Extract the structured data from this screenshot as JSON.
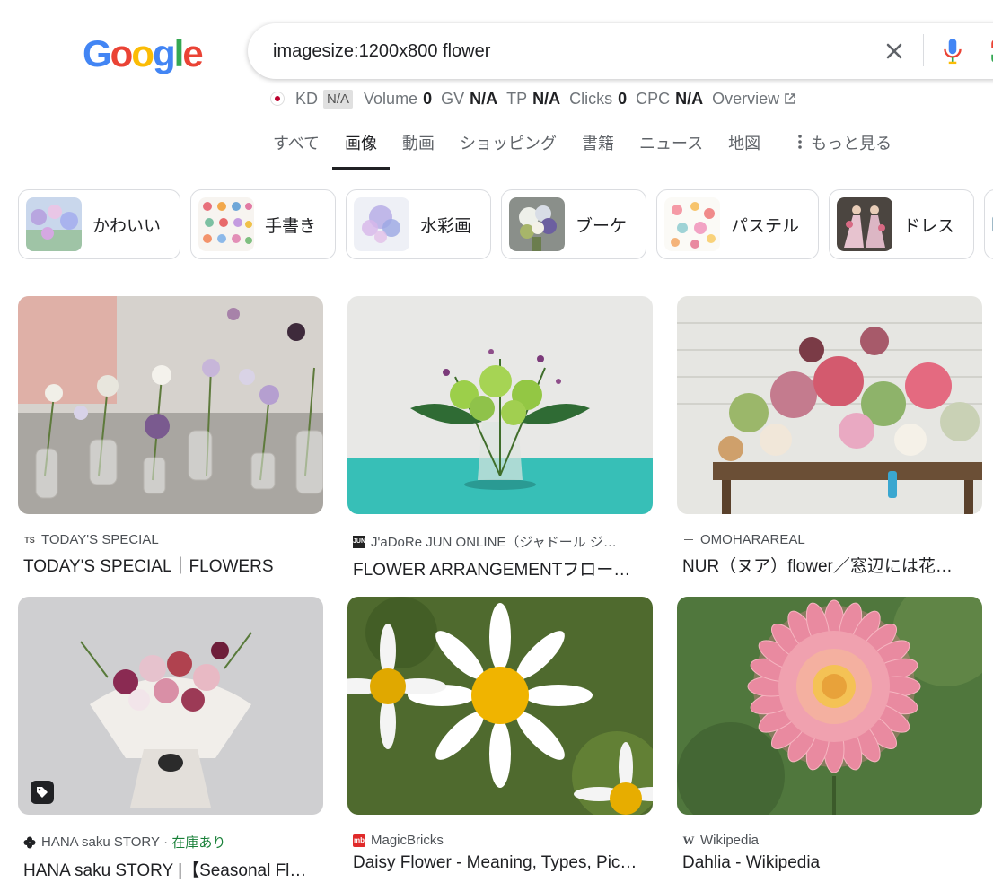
{
  "logo": {
    "text": "Google"
  },
  "search": {
    "query": "imagesize:1200x800 flower"
  },
  "seo": {
    "kd_label": "KD",
    "kd_value": "N/A",
    "volume_label": "Volume",
    "volume_value": "0",
    "gv_label": "GV",
    "gv_value": "N/A",
    "tp_label": "TP",
    "tp_value": "N/A",
    "clicks_label": "Clicks",
    "clicks_value": "0",
    "cpc_label": "CPC",
    "cpc_value": "N/A",
    "overview_label": "Overview"
  },
  "tabs": [
    {
      "label": "すべて"
    },
    {
      "label": "画像",
      "active": true
    },
    {
      "label": "動画"
    },
    {
      "label": "ショッピング"
    },
    {
      "label": "書籍"
    },
    {
      "label": "ニュース"
    },
    {
      "label": "地図"
    },
    {
      "label": "もっと見る"
    }
  ],
  "chips": [
    {
      "label": "かわいい"
    },
    {
      "label": "手書き"
    },
    {
      "label": "水彩画"
    },
    {
      "label": "ブーケ"
    },
    {
      "label": "パステル"
    },
    {
      "label": "ドレス"
    }
  ],
  "results": [
    {
      "source": "TODAY'S SPECIAL",
      "title": "TODAY'S SPECIAL｜FLOWERS"
    },
    {
      "source": "J'aDoRe JUN ONLINE（ジャドール ジ…",
      "title": "FLOWER ARRANGEMENTフロー…"
    },
    {
      "source": "OMOHARAREAL",
      "title": "NUR（ヌア）flower／窓辺には花を …"
    },
    {
      "source": "HANA saku STORY",
      "stock": "在庫あり",
      "title": "HANA saku STORY |【Seasonal Fl…"
    },
    {
      "source": "MagicBricks",
      "title": "Daisy Flower - Meaning, Types, Pic…"
    },
    {
      "source": "Wikipedia",
      "title": "Dahlia - Wikipedia"
    }
  ],
  "colors": {
    "google_blue": "#4285F4",
    "google_red": "#EA4335",
    "google_yellow": "#FBBC05",
    "google_green": "#34A853",
    "stock_green": "#188038"
  }
}
